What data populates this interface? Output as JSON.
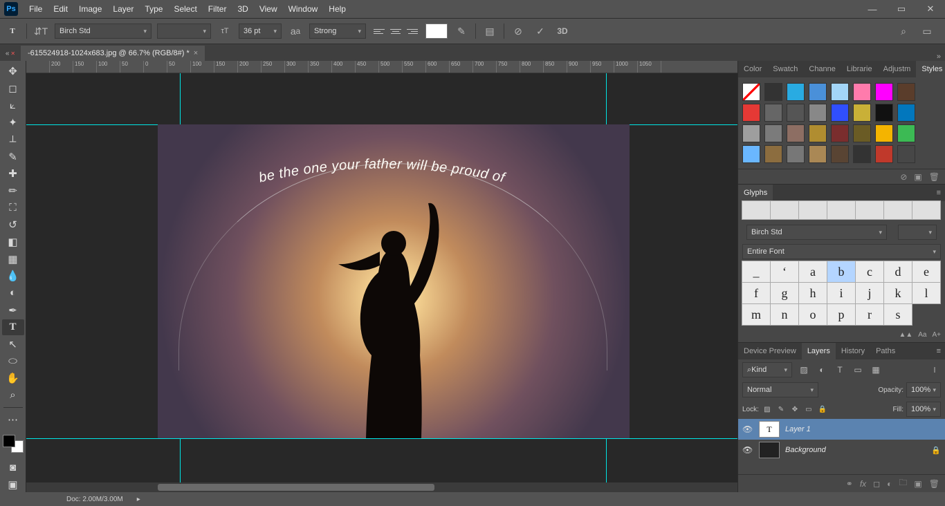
{
  "menus": [
    "File",
    "Edit",
    "Image",
    "Layer",
    "Type",
    "Select",
    "Filter",
    "3D",
    "View",
    "Window",
    "Help"
  ],
  "options": {
    "font_family": "Birch Std",
    "font_style": "",
    "font_size": "36 pt",
    "aa": "Strong"
  },
  "doc_tab": "-615524918-1024x683.jpg @ 66.7% (RGB/8#) *",
  "ruler_ticks": [
    "",
    "200",
    "150",
    "100",
    "50",
    "0",
    "50",
    "100",
    "150",
    "200",
    "250",
    "300",
    "350",
    "400",
    "450",
    "500",
    "550",
    "600",
    "650",
    "700",
    "750",
    "800",
    "850",
    "900",
    "950",
    "1000",
    "1050"
  ],
  "canvas_text": "be the one your father will be proud of",
  "panel_tabs_top": [
    "Color",
    "Swatch",
    "Channe",
    "Librarie",
    "Adjustm",
    "Styles"
  ],
  "swatch_colors": [
    "none",
    "#333",
    "#29abe2",
    "#4a90d9",
    "#a3d5f7",
    "#ff7bac",
    "#ff00ff",
    "#5a3d2b",
    "#e53935",
    "#666",
    "#555",
    "#888",
    "#304ffe",
    "#c9b037",
    "#111",
    "#0277bd",
    "#9e9e9e",
    "#7b7b7b",
    "#8d6e63",
    "#b08d30",
    "#7a2d2d",
    "#6a5b25",
    "#f4b400",
    "#3cba54",
    "#6ab7ff",
    "#8c6d3f",
    "#777",
    "#aa8855",
    "#594433",
    "#333333",
    "#c0392b",
    ""
  ],
  "glyphs_label": "Glyphs",
  "glyph_font": "Birch Std",
  "glyph_range": "Entire Font",
  "glyph_cells": [
    "_",
    "‘",
    "a",
    "b",
    "c",
    "d",
    "e",
    "f",
    "g",
    "h",
    "i",
    "j",
    "k",
    "l",
    "m",
    "n",
    "o",
    "p",
    "r",
    "s"
  ],
  "glyph_selected_index": 3,
  "glyph_footer": [
    "▲▲",
    "Aa",
    "A+"
  ],
  "layer_tabs": [
    "Device Preview",
    "Layers",
    "History",
    "Paths"
  ],
  "layer_filter": "Kind",
  "blend_mode": "Normal",
  "opacity_label": "Opacity:",
  "opacity_value": "100%",
  "lock_label": "Lock:",
  "fill_label": "Fill:",
  "fill_value": "100%",
  "layers": [
    {
      "name": "Layer 1",
      "type": "T",
      "locked": false
    },
    {
      "name": "Background",
      "type": "img",
      "locked": true
    }
  ],
  "status": {
    "zoom": "",
    "doc_size": "Doc: 2.00M/3.00M"
  }
}
